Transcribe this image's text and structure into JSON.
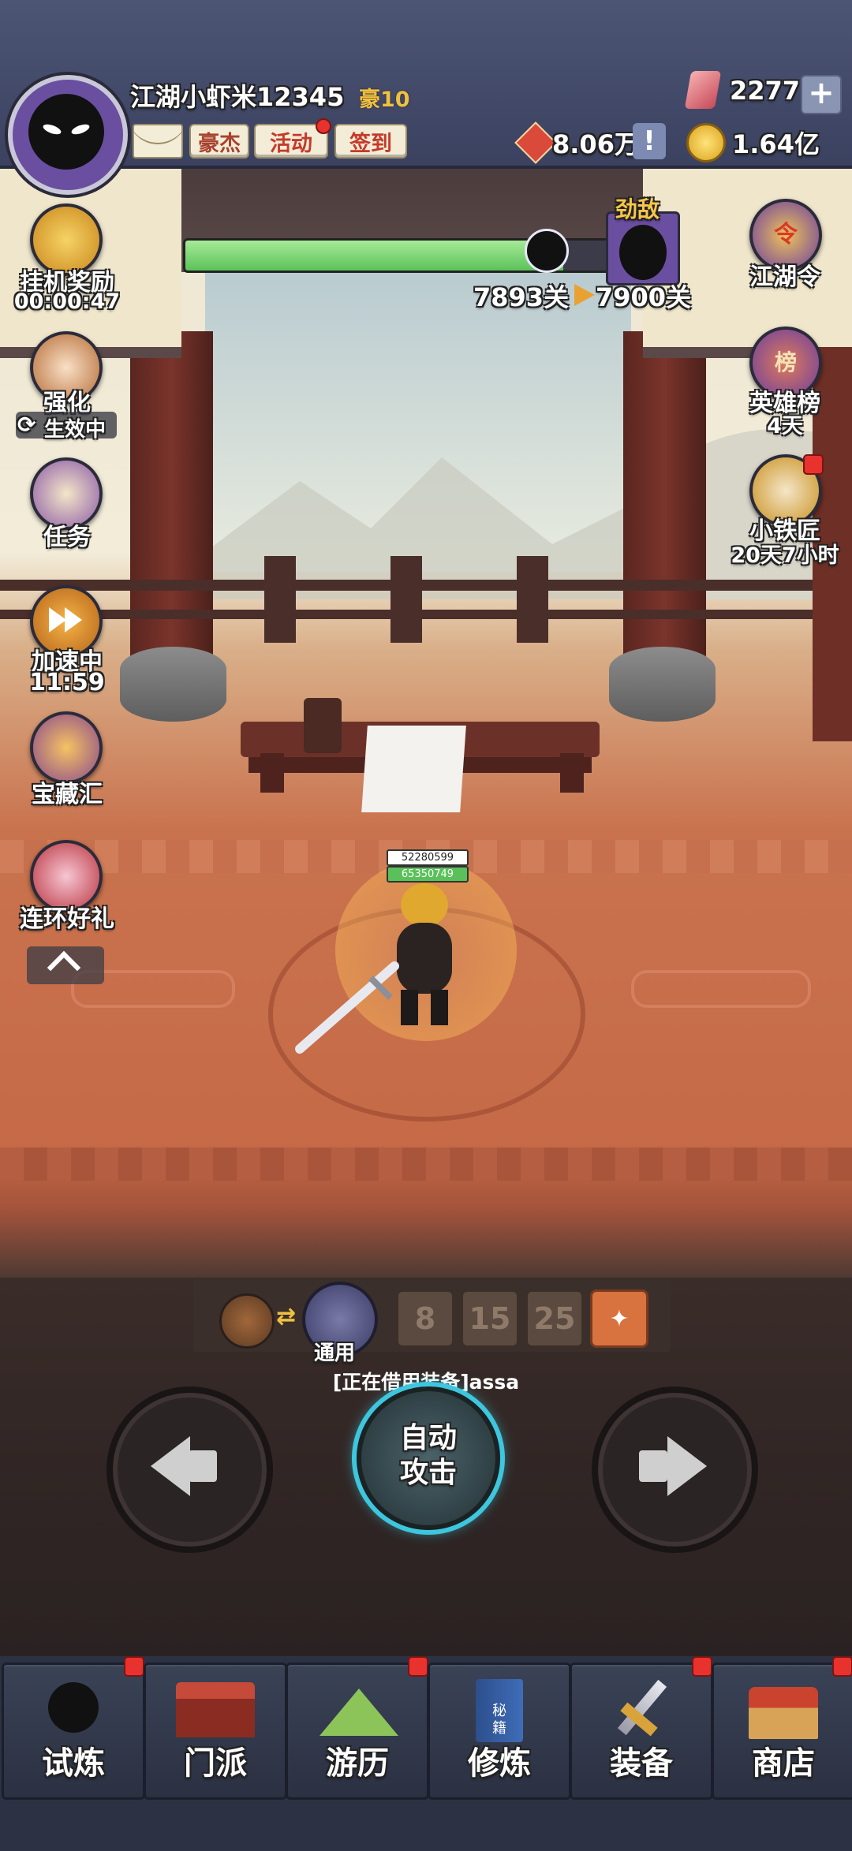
{
  "player": {
    "name": "江湖小虾米12345",
    "vip": "豪10"
  },
  "header_buttons": {
    "heroes": "豪杰",
    "activity": "活动",
    "signin": "签到"
  },
  "currency": {
    "gems": "2277",
    "honor": "8.06万",
    "gold": "1.64亿"
  },
  "stage": {
    "current": "7893关",
    "target": "7900关",
    "boss_label": "劲敌",
    "progress": 0.87
  },
  "left_menu": {
    "idle_reward": "挂机奖励",
    "idle_timer": "00:00:47",
    "strengthen": "强化",
    "strengthen_status": "生效中",
    "tasks": "任务",
    "speedup": "加速中",
    "speedup_timer": "11:59",
    "treasure": "宝藏汇",
    "gift": "连环好礼"
  },
  "right_menu": {
    "jianghu_token": "江湖令",
    "hero_rank": "英雄榜",
    "hero_rank_days": "4天",
    "blacksmith": "小铁匠",
    "blacksmith_time": "20天7小时"
  },
  "player_stats": {
    "shield": "52280599",
    "hp": "65350749"
  },
  "weapon": {
    "label": "通用",
    "borrow_text": "[正在借用装备]assa",
    "skill_levels": [
      "8",
      "15",
      "25"
    ]
  },
  "controls": {
    "auto_attack": "自动\n攻击"
  },
  "tabs": [
    "试炼",
    "门派",
    "游历",
    "修炼",
    "装备",
    "商店"
  ],
  "tab_badges": [
    true,
    false,
    true,
    false,
    true,
    true
  ],
  "tab_icons": [
    "ninja-icon",
    "gate-icon",
    "mountain-icon",
    "book-icon",
    "sword-icon",
    "shop-icon"
  ],
  "tab_icon_text": {
    "book": "秘\n籍"
  },
  "icon_text": {
    "rank": "榜",
    "token": "令"
  },
  "colors": {
    "progress": "#77d66a",
    "accent": "#e24a3b",
    "gold": "#f0c040"
  }
}
